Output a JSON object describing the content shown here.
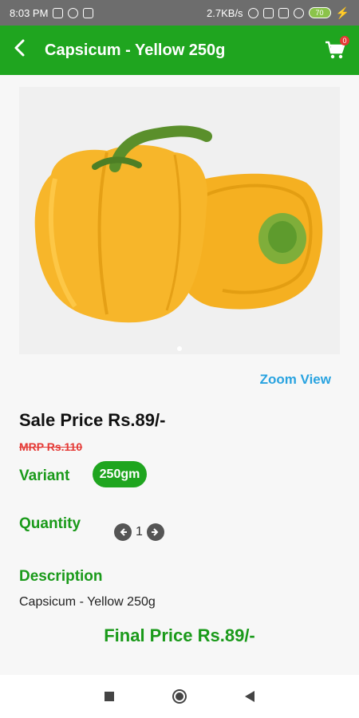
{
  "status": {
    "time": "8:03 PM",
    "speed": "2.7KB/s",
    "battery": "70"
  },
  "header": {
    "title": "Capsicum - Yellow 250g",
    "cart_count": "0"
  },
  "product": {
    "zoom_label": "Zoom View",
    "sale_price": "Sale Price Rs.89/-",
    "mrp": "MRP Rs.110",
    "variant_label": "Variant",
    "variant_value": "250gm",
    "quantity_label": "Quantity",
    "quantity_value": "1",
    "description_label": "Description",
    "description_text": "Capsicum - Yellow 250g",
    "final_price": "Final Price Rs.89/-"
  },
  "colors": {
    "brand_green": "#1fa51f",
    "link_blue": "#29a3e0",
    "mrp_red": "#e53935"
  },
  "icons": [
    "back-arrow-icon",
    "cart-icon",
    "chevron-left-icon",
    "chevron-right-icon",
    "recents-square-icon",
    "home-circle-icon",
    "back-triangle-icon"
  ]
}
